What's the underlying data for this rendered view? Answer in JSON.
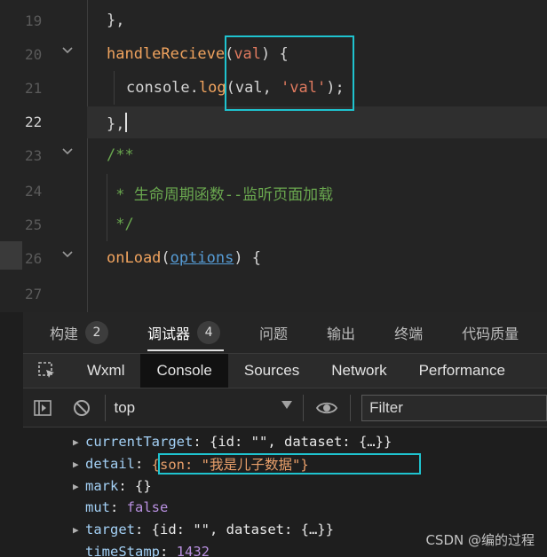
{
  "editor": {
    "lines": [
      {
        "num": "19",
        "tokens": [
          {
            "t": "},",
            "c": "c-punc"
          }
        ]
      },
      {
        "num": "20",
        "tokens": [
          {
            "t": "handleRecieve",
            "c": "c-fn"
          },
          {
            "t": "(",
            "c": "c-punc"
          },
          {
            "t": "val",
            "c": "c-param"
          },
          {
            "t": ") {",
            "c": "c-punc"
          }
        ]
      },
      {
        "num": "21",
        "tokens": [
          {
            "t": "console",
            "c": "c-kw"
          },
          {
            "t": ".",
            "c": "c-punc"
          },
          {
            "t": "log",
            "c": "c-fn"
          },
          {
            "t": "(val, ",
            "c": "c-punc"
          },
          {
            "t": "'val'",
            "c": "c-str"
          },
          {
            "t": ");",
            "c": "c-punc"
          }
        ]
      },
      {
        "num": "22",
        "tokens": [
          {
            "t": "},",
            "c": "c-punc"
          }
        ]
      },
      {
        "num": "23",
        "tokens": [
          {
            "t": "/**",
            "c": "c-cmt"
          }
        ]
      },
      {
        "num": "24",
        "tokens": [
          {
            "t": " * 生命周期函数--监听页面加载",
            "c": "c-cmt"
          }
        ]
      },
      {
        "num": "25",
        "tokens": [
          {
            "t": " */",
            "c": "c-cmt"
          }
        ]
      },
      {
        "num": "26",
        "tokens": [
          {
            "t": "onLoad",
            "c": "c-fn"
          },
          {
            "t": "(",
            "c": "c-punc"
          },
          {
            "t": "options",
            "c": "c-opt"
          },
          {
            "t": ") {",
            "c": "c-punc"
          }
        ]
      },
      {
        "num": "27",
        "tokens": []
      }
    ]
  },
  "panel_tabs": [
    {
      "label": "构建",
      "badge": "2"
    },
    {
      "label": "调试器",
      "badge": "4"
    },
    {
      "label": "问题",
      "badge": ""
    },
    {
      "label": "输出",
      "badge": ""
    },
    {
      "label": "终端",
      "badge": ""
    },
    {
      "label": "代码质量",
      "badge": ""
    }
  ],
  "devtools_tabs": [
    "Wxml",
    "Console",
    "Sources",
    "Network",
    "Performance"
  ],
  "console_toolbar": {
    "context": "top",
    "filter_placeholder": "Filter"
  },
  "console_rows": [
    {
      "key": "currentTarget",
      "value": "{id: \"\", dataset: {…}}",
      "expandable": true
    },
    {
      "key": "detail",
      "value": "{son: \"我是儿子数据\"}",
      "expandable": true
    },
    {
      "key": "mark",
      "value": "{}",
      "expandable": true
    },
    {
      "key": "mut",
      "value": "false",
      "expandable": false
    },
    {
      "key": "target",
      "value": "{id: \"\", dataset: {…}}",
      "expandable": true
    },
    {
      "key": "timeStamp",
      "value": "1432",
      "expandable": false
    }
  ],
  "watermark": "CSDN @编的过程",
  "colors": {
    "highlight_box": "#1fc3cf",
    "editor_bg": "#242424",
    "console_bg": "#1e1e1e"
  }
}
